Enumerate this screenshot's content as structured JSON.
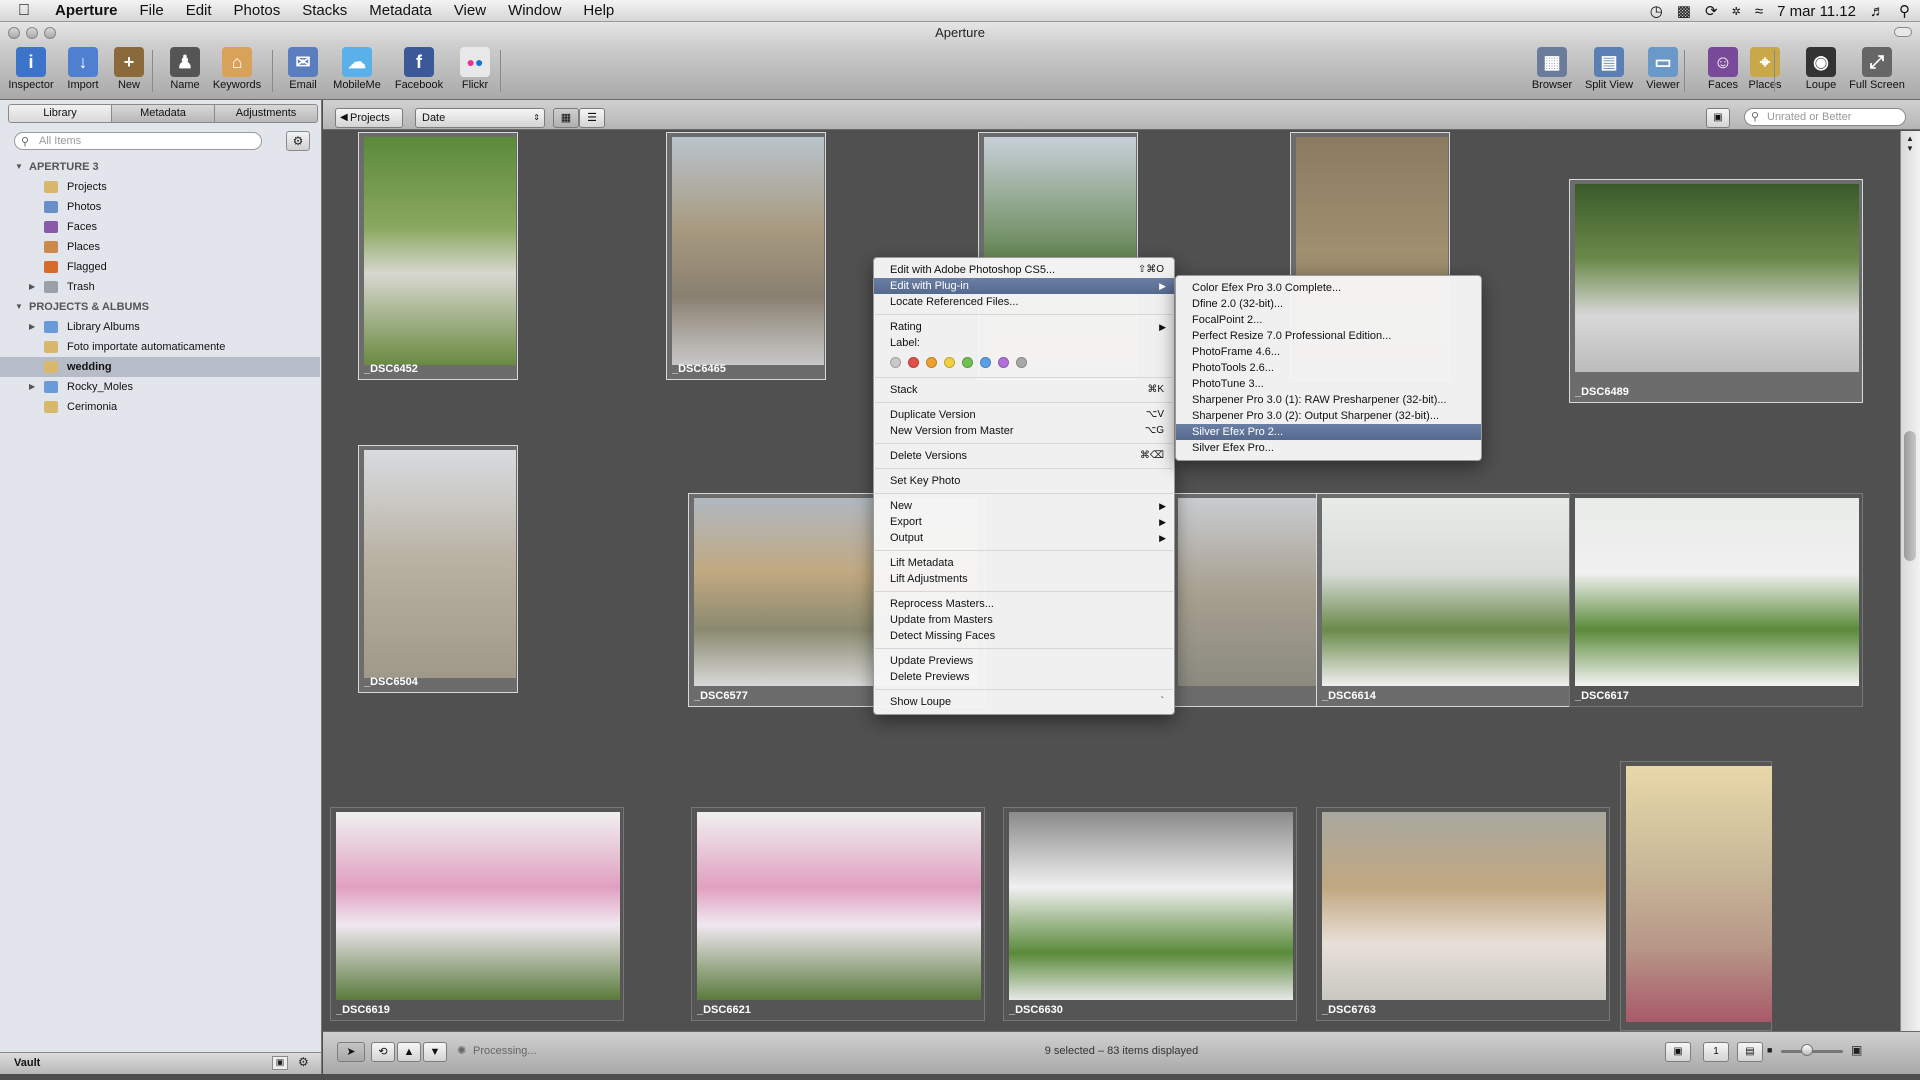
{
  "menubar": {
    "apple": "",
    "app": "Aperture",
    "items": [
      "File",
      "Edit",
      "Photos",
      "Stacks",
      "Metadata",
      "View",
      "Window",
      "Help"
    ],
    "datetime": "7 mar  11.12"
  },
  "window": {
    "title": "Aperture"
  },
  "toolbar": {
    "left": [
      {
        "label": "Inspector",
        "icon": "inspector-icon",
        "color": "#3b74c9",
        "glyph": "i"
      },
      {
        "label": "Import",
        "icon": "import-icon",
        "color": "#4f7fd0",
        "glyph": "↓"
      },
      {
        "label": "New",
        "icon": "new-icon",
        "color": "#8a6a3a",
        "glyph": "+"
      },
      {
        "label": "Name",
        "icon": "name-icon",
        "color": "#555",
        "glyph": "♟"
      },
      {
        "label": "Keywords",
        "icon": "keywords-icon",
        "color": "#d9a25a",
        "glyph": "⌂"
      },
      {
        "label": "Email",
        "icon": "email-icon",
        "color": "#5a7dc0",
        "glyph": "✉"
      },
      {
        "label": "MobileMe",
        "icon": "mobileme-icon",
        "color": "#5ab0e8",
        "glyph": "☁"
      },
      {
        "label": "Facebook",
        "icon": "facebook-icon",
        "color": "#3b5998",
        "glyph": "f"
      },
      {
        "label": "Flickr",
        "icon": "flickr-icon",
        "color": "#e8e8e8",
        "glyph": "●"
      }
    ],
    "right": [
      {
        "label": "Browser",
        "icon": "browser-icon",
        "color": "#6a7c9a",
        "glyph": "▦"
      },
      {
        "label": "Split View",
        "icon": "split-view-icon",
        "color": "#5a7fb5",
        "glyph": "▤"
      },
      {
        "label": "Viewer",
        "icon": "viewer-icon",
        "color": "#6a98c8",
        "glyph": "▭"
      },
      {
        "label": "Faces",
        "icon": "faces-icon",
        "color": "#7a4a9a",
        "glyph": "☺"
      },
      {
        "label": "Places",
        "icon": "places-icon",
        "color": "#c9a84a",
        "glyph": "⌖"
      },
      {
        "label": "Loupe",
        "icon": "loupe-icon",
        "color": "#333",
        "glyph": "◉"
      },
      {
        "label": "Full Screen",
        "icon": "full-screen-icon",
        "color": "#666",
        "glyph": "⤢"
      }
    ]
  },
  "library": {
    "tabs": [
      "Library",
      "Metadata",
      "Adjustments"
    ],
    "search_placeholder": "All Items",
    "sections": [
      {
        "label": "APERTURE 3",
        "header": true
      },
      {
        "label": "Projects",
        "icon": "projects-icon",
        "color": "#d8b86a"
      },
      {
        "label": "Photos",
        "icon": "photos-icon",
        "color": "#6a8fc8"
      },
      {
        "label": "Faces",
        "icon": "faces-icon",
        "color": "#8a5aa8"
      },
      {
        "label": "Places",
        "icon": "places-icon",
        "color": "#c98a4a"
      },
      {
        "label": "Flagged",
        "icon": "flag-icon",
        "color": "#d86a2a"
      },
      {
        "label": "Trash",
        "icon": "trash-icon",
        "color": "#9aa0a8",
        "expandable": true
      },
      {
        "label": "PROJECTS & ALBUMS",
        "header": true
      },
      {
        "label": "Library Albums",
        "icon": "folder-icon",
        "color": "#6a9ad8",
        "expandable": true
      },
      {
        "label": "Foto importate automaticamente",
        "icon": "project-icon",
        "color": "#d8b86a"
      },
      {
        "label": "wedding",
        "icon": "project-icon",
        "color": "#d8b86a",
        "selected": true
      },
      {
        "label": "Rocky_Moles",
        "icon": "folder-icon",
        "color": "#6a9ad8",
        "expandable": true
      },
      {
        "label": "Cerimonia",
        "icon": "project-icon",
        "color": "#d8b86a"
      }
    ],
    "vault": "Vault"
  },
  "browser": {
    "projects_button": "Projects",
    "sort_value": "Date",
    "rating_filter": "Unrated or Better",
    "status": "9 selected – 83 items displayed",
    "processing": "Processing..."
  },
  "thumbnails": [
    {
      "name": "_DSC6452",
      "selected": true
    },
    {
      "name": "_DSC6465",
      "selected": true
    },
    {
      "name": "",
      "selected": true
    },
    {
      "name": "",
      "selected": true
    },
    {
      "name": "_DSC6489",
      "selected": true
    },
    {
      "name": "_DSC6504",
      "selected": true
    },
    {
      "name": "_DSC6577",
      "selected": true
    },
    {
      "name": "",
      "selected": true
    },
    {
      "name": "_DSC6614",
      "selected": true
    },
    {
      "name": "_DSC6617",
      "selected": false
    },
    {
      "name": "_DSC6619",
      "selected": false
    },
    {
      "name": "_DSC6621",
      "selected": false
    },
    {
      "name": "_DSC6630",
      "selected": false
    },
    {
      "name": "_DSC6763",
      "selected": false
    },
    {
      "name": "",
      "selected": false
    }
  ],
  "context_menu": {
    "items": [
      {
        "label": "Edit with Adobe Photoshop CS5...",
        "shortcut": "⇧⌘O"
      },
      {
        "label": "Edit with Plug-in",
        "submenu": true,
        "highlight": true
      },
      {
        "label": "Locate Referenced Files..."
      },
      {
        "sep": true
      },
      {
        "label": "Rating",
        "submenu": true
      },
      {
        "label": "Label:"
      },
      {
        "label": "",
        "colors": [
          "#c8c8c8",
          "#e0504a",
          "#f0a030",
          "#f0d040",
          "#70c050",
          "#5aa0e8",
          "#b070d8",
          "#a8a8a8"
        ]
      },
      {
        "sep": true
      },
      {
        "label": "Stack",
        "shortcut": "⌘K"
      },
      {
        "sep": true
      },
      {
        "label": "Duplicate Version",
        "shortcut": "⌥V"
      },
      {
        "label": "New Version from Master",
        "shortcut": "⌥G"
      },
      {
        "sep": true
      },
      {
        "label": "Delete Versions",
        "shortcut": "⌘⌫"
      },
      {
        "sep": true
      },
      {
        "label": "Set Key Photo"
      },
      {
        "sep": true
      },
      {
        "label": "New",
        "submenu": true
      },
      {
        "label": "Export",
        "submenu": true
      },
      {
        "label": "Output",
        "submenu": true
      },
      {
        "sep": true
      },
      {
        "label": "Lift Metadata"
      },
      {
        "label": "Lift Adjustments"
      },
      {
        "sep": true
      },
      {
        "label": "Reprocess Masters..."
      },
      {
        "label": "Update from Masters"
      },
      {
        "label": "Detect Missing Faces"
      },
      {
        "sep": true
      },
      {
        "label": "Update Previews"
      },
      {
        "label": "Delete Previews"
      },
      {
        "sep": true
      },
      {
        "label": "Show Loupe",
        "shortcut": "`"
      }
    ]
  },
  "plugin_submenu": {
    "items": [
      {
        "label": "Color Efex Pro 3.0 Complete..."
      },
      {
        "label": "Dfine 2.0 (32-bit)..."
      },
      {
        "label": "FocalPoint 2..."
      },
      {
        "label": "Perfect Resize 7.0 Professional Edition..."
      },
      {
        "label": "PhotoFrame 4.6..."
      },
      {
        "label": "PhotoTools 2.6..."
      },
      {
        "label": "PhotoTune 3..."
      },
      {
        "label": "Sharpener Pro 3.0 (1): RAW Presharpener (32-bit)..."
      },
      {
        "label": "Sharpener Pro 3.0 (2): Output Sharpener (32-bit)..."
      },
      {
        "label": "Silver Efex Pro 2...",
        "highlight": true
      },
      {
        "label": "Silver Efex Pro..."
      }
    ]
  }
}
